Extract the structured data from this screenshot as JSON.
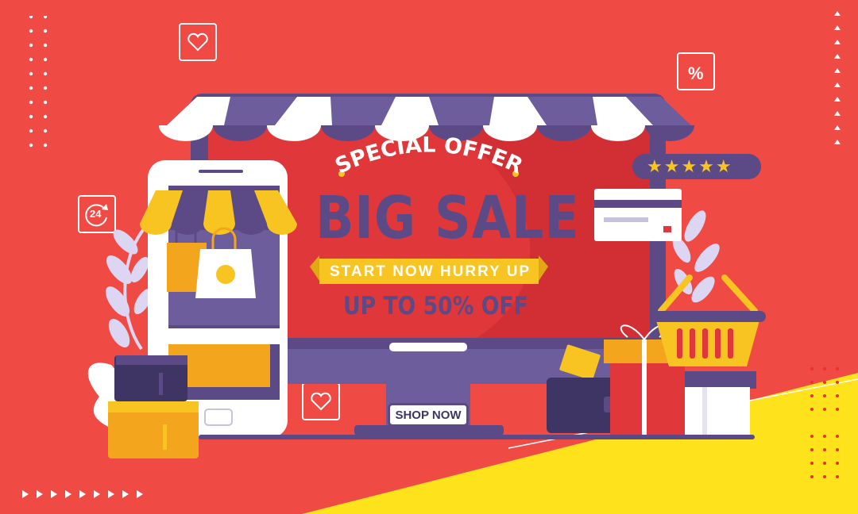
{
  "banner": {
    "kicker": "SPECIAL OFFER",
    "headline": "BIG SALE",
    "ribbon": "START NOW HURRY UP",
    "discount": "UP TO 50% OFF",
    "cta": "SHOP NOW",
    "rating_stars": 5,
    "icon_labels": {
      "hours": "24",
      "percent": "%"
    }
  },
  "colors": {
    "background": "#f04a45",
    "accent_yellow": "#f7c421",
    "purple": "#5b4a86",
    "white": "#ffffff"
  }
}
